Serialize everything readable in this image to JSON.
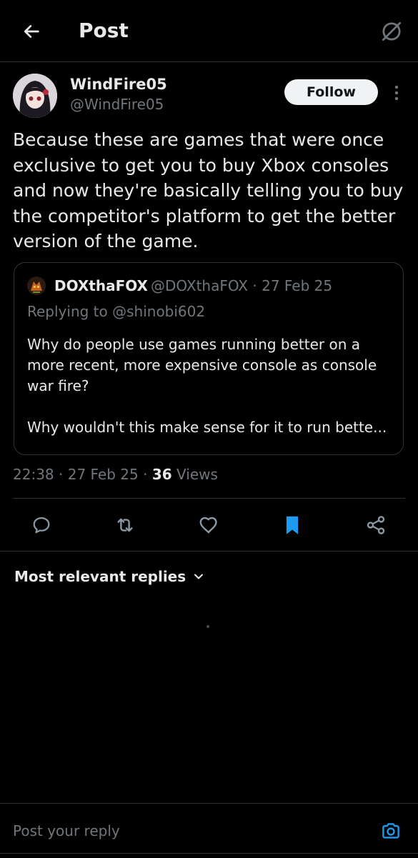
{
  "header": {
    "title": "Post"
  },
  "post": {
    "author": {
      "display_name": "WindFire05",
      "handle": "@WindFire05"
    },
    "follow_label": "Follow",
    "text": "Because these are games that were once exclusive to get you to buy Xbox consoles and now they're basically telling you to buy the competitor's platform to get the better version of the game.",
    "quoted": {
      "author_name": "DOXthaFOX",
      "author_handle": "@DOXthaFOX",
      "date": "27 Feb 25",
      "meta_separator": "·",
      "replying_to": "Replying to @shinobi602",
      "paragraphs": [
        "Why do people use games running better on a more recent, more expensive console as console war fire?",
        "Why wouldn't this make sense for it to run bette..."
      ]
    },
    "time": "22:38",
    "date": "27 Feb 25",
    "separator": "·",
    "views_count": "36",
    "views_label": "Views"
  },
  "actions": {
    "icons": [
      "reply-icon",
      "repost-icon",
      "like-icon",
      "bookmark-icon",
      "share-icon"
    ],
    "bookmark_color": "#1d9bf0"
  },
  "replies": {
    "sort_label": "Most relevant replies"
  },
  "reply_box": {
    "placeholder": "Post your reply"
  },
  "colors": {
    "background": "#000000",
    "text": "#e7e9ea",
    "muted": "#71767b",
    "divider": "#2f3336",
    "accent": "#1d9bf0"
  }
}
